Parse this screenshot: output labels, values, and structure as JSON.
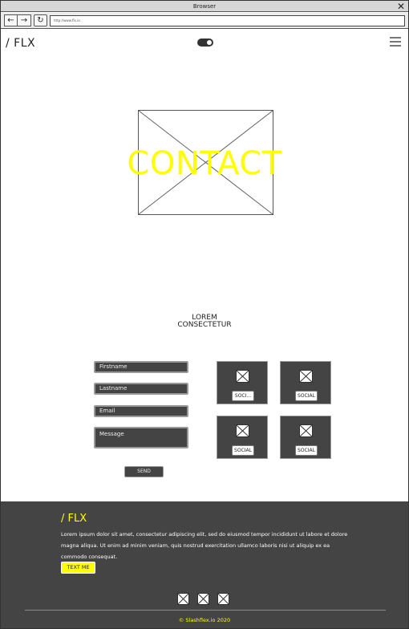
{
  "browser": {
    "title": "Browser",
    "close": "✕",
    "back": "←",
    "forward": "→",
    "reload": "↻",
    "url": "http://www.flx.io"
  },
  "header": {
    "logo": "/ FLX",
    "menu_icon": "hamburger-icon",
    "toggle_icon": "toggle-switch"
  },
  "hero": {
    "title": "CONTACT",
    "image_icon": "image-placeholder"
  },
  "subhead": {
    "line1": "LOREM",
    "line2": "CONSECTETUR"
  },
  "form": {
    "firstname": "Firstname",
    "lastname": "Lastname",
    "email": "Email",
    "message": "Message",
    "send": "SEND"
  },
  "social": [
    {
      "label": "SOCI..."
    },
    {
      "label": "SOCIAL"
    },
    {
      "label": "SOCIAL"
    },
    {
      "label": "SOCIAL"
    }
  ],
  "footer": {
    "logo": "/ FLX",
    "text": "Lorem ipsum dolor sit amet, consectetur adipiscing elit, sed do eiusmod tempor incididunt ut labore et dolore magna aliqua. Ut enim ad minim veniam, quis nostrud exercitation ullamco laboris nisi ut aliquip ex ea commodo consequat.",
    "button": "TEXT ME",
    "copyright": "© Slashflex.io 2020"
  },
  "colors": {
    "accent": "#ffff00",
    "footer_bg": "#444444"
  }
}
